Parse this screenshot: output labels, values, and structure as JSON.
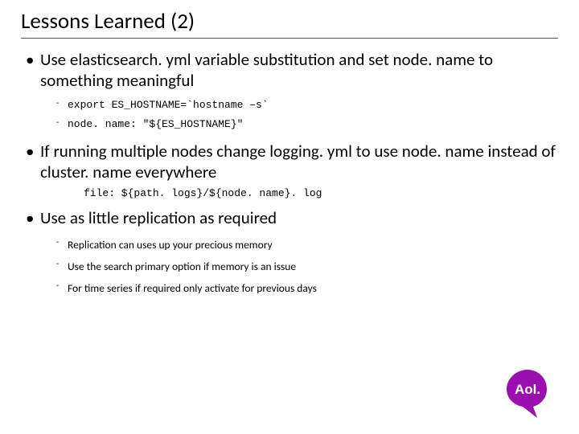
{
  "title": "Lessons Learned (2)",
  "bullets": [
    {
      "text": "Use elasticsearch. yml variable substitution and set node. name to something meaningful",
      "code_subs": [
        "export ES_HOSTNAME=`hostname –s`",
        "node. name: \"${ES_HOSTNAME}\""
      ]
    },
    {
      "text": "If running multiple nodes change logging. yml to use node. name instead of cluster. name everywhere",
      "code_line": "file: ${path. logs}/${node. name}. log"
    },
    {
      "text": "Use as little replication as required",
      "text_subs": [
        "Replication can uses up your precious memory",
        "Use the search primary option if memory is an issue",
        "For time series if required only activate for previous days"
      ]
    }
  ],
  "logo": {
    "name": "Aol.",
    "color": "#9b0fb0"
  }
}
